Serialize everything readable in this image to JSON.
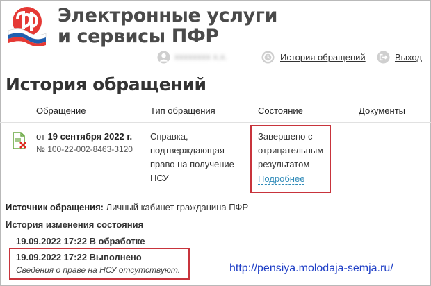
{
  "header": {
    "brand_line1": "Электронные услуги",
    "brand_line2": "и сервисы ПФР",
    "user_name": "xxxxxxxx x.x.",
    "history_link": "История обращений",
    "exit_link": "Выход"
  },
  "page": {
    "title": "История обращений"
  },
  "table": {
    "columns": [
      "Обращение",
      "Тип обращения",
      "Состояние",
      "Документы"
    ],
    "row": {
      "date_prefix": "от",
      "date": "19 сентября 2022 г.",
      "number": "№ 100-22-002-8463-3120",
      "type_lines": [
        "Справка,",
        "подтверждающая",
        "право на получение",
        "НСУ"
      ],
      "status_lines": [
        "Завершено с",
        "отрицательным",
        "результатом"
      ],
      "more_link": "Подробнее"
    }
  },
  "source": {
    "label": "Источник обращения:",
    "value": "Личный кабинет гражданина ПФР"
  },
  "history": {
    "title": "История изменения состояния",
    "entries": [
      {
        "text": "19.09.2022 17:22 В обработке"
      },
      {
        "text": "19.09.2022 17:22 Выполнено",
        "note": "Сведения о праве на НСУ отсутствуют."
      }
    ]
  },
  "watermark": "http://pensiya.molodaja-semja.ru/",
  "colors": {
    "highlight_border": "#c8343c",
    "link_blue": "#2f8ab8",
    "watermark_blue": "#1f3fc6",
    "logo_red": "#e53935",
    "flag_blue": "#1f5fb0"
  }
}
